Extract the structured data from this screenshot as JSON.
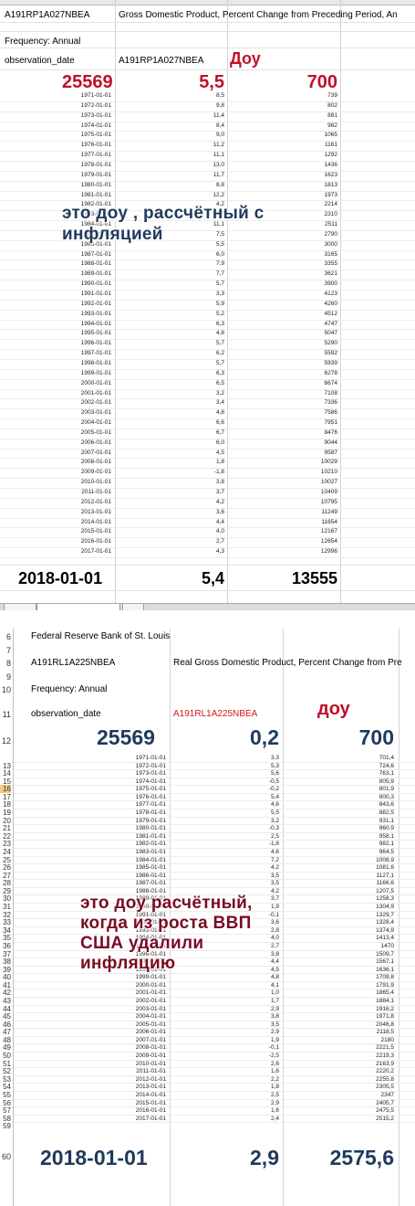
{
  "sheet1": {
    "header_cells": {
      "series_id": "A191RP1A027NBEA",
      "series_title": "Gross Domestic Product, Percent Change from Preceding Period, An",
      "frequency": "Frequency: Annual",
      "obs_date_label": "observation_date",
      "obs_series_label": "A191RP1A027NBEA",
      "dow_label": "Доу"
    },
    "first_row": {
      "date": "25569",
      "value": "5,5",
      "dow": "700"
    },
    "rows": [
      [
        "1971-01-01",
        "8,5",
        "739"
      ],
      [
        "1972-01-01",
        "9,8",
        "802"
      ],
      [
        "1973-01-01",
        "11,4",
        "881"
      ],
      [
        "1974-01-01",
        "8,4",
        "982"
      ],
      [
        "1975-01-01",
        "9,0",
        "1065"
      ],
      [
        "1976-01-01",
        "11,2",
        "1161"
      ],
      [
        "1977-01-01",
        "11,1",
        "1292"
      ],
      [
        "1978-01-01",
        "13,0",
        "1436"
      ],
      [
        "1979-01-01",
        "11,7",
        "1623"
      ],
      [
        "1980-01-01",
        "8,8",
        "1813"
      ],
      [
        "1981-01-01",
        "12,2",
        "1973"
      ],
      [
        "1982-01-01",
        "4,2",
        "2214"
      ],
      [
        "1983-01-01",
        "8,7",
        "2310"
      ],
      [
        "1984-01-01",
        "11,1",
        "2511"
      ],
      [
        "1985-01-01",
        "7,5",
        "2790"
      ],
      [
        "1986-01-01",
        "5,5",
        "3000"
      ],
      [
        "1987-01-01",
        "6,0",
        "3165"
      ],
      [
        "1988-01-01",
        "7,9",
        "3355"
      ],
      [
        "1989-01-01",
        "7,7",
        "3621"
      ],
      [
        "1990-01-01",
        "5,7",
        "3900"
      ],
      [
        "1991-01-01",
        "3,3",
        "4123"
      ],
      [
        "1992-01-01",
        "5,9",
        "4260"
      ],
      [
        "1993-01-01",
        "5,2",
        "4512"
      ],
      [
        "1994-01-01",
        "6,3",
        "4747"
      ],
      [
        "1995-01-01",
        "4,8",
        "5047"
      ],
      [
        "1996-01-01",
        "5,7",
        "5290"
      ],
      [
        "1997-01-01",
        "6,2",
        "5592"
      ],
      [
        "1998-01-01",
        "5,7",
        "5939"
      ],
      [
        "1999-01-01",
        "6,3",
        "6278"
      ],
      [
        "2000-01-01",
        "6,5",
        "6674"
      ],
      [
        "2001-01-01",
        "3,2",
        "7108"
      ],
      [
        "2002-01-01",
        "3,4",
        "7336"
      ],
      [
        "2003-01-01",
        "4,8",
        "7586"
      ],
      [
        "2004-01-01",
        "6,6",
        "7951"
      ],
      [
        "2005-01-01",
        "6,7",
        "8476"
      ],
      [
        "2006-01-01",
        "6,0",
        "9044"
      ],
      [
        "2007-01-01",
        "4,5",
        "9587"
      ],
      [
        "2008-01-01",
        "1,8",
        "10029"
      ],
      [
        "2009-01-01",
        "-1,8",
        "10210"
      ],
      [
        "2010-01-01",
        "3,8",
        "10027"
      ],
      [
        "2011-01-01",
        "3,7",
        "10409"
      ],
      [
        "2012-01-01",
        "4,2",
        "10795"
      ],
      [
        "2013-01-01",
        "3,6",
        "11249"
      ],
      [
        "2014-01-01",
        "4,4",
        "11654"
      ],
      [
        "2015-01-01",
        "4,0",
        "12167"
      ],
      [
        "2016-01-01",
        "2,7",
        "12654"
      ],
      [
        "2017-01-01",
        "4,3",
        "12996"
      ]
    ],
    "last_row": {
      "date": "2018-01-01",
      "value": "5,4",
      "dow": "13555"
    },
    "overlay_text": [
      "это доу , рассчётный с",
      "инфляцией"
    ]
  },
  "sheet2": {
    "row_numbers": [
      "6",
      "7",
      "8",
      "9",
      "10",
      "11",
      "12",
      "13",
      "14",
      "15",
      "16",
      "17",
      "18",
      "19",
      "20",
      "21",
      "22",
      "23",
      "24",
      "25",
      "26",
      "27",
      "28",
      "29",
      "30",
      "31",
      "32",
      "33",
      "34",
      "35",
      "36",
      "37",
      "38",
      "39",
      "40",
      "41",
      "42",
      "43",
      "44",
      "45",
      "46",
      "47",
      "48",
      "49",
      "50",
      "51",
      "52",
      "53",
      "54",
      "55",
      "56",
      "57",
      "58",
      "59",
      "60"
    ],
    "header_cells": {
      "source": "Federal Reserve Bank of St. Louis",
      "series_id": "A191RL1A225NBEA",
      "series_title": "Real Gross Domestic Product, Percent Change from Pre",
      "frequency": "Frequency: Annual",
      "obs_date_label": "observation_date",
      "obs_series_label": "A191RL1A225NBEA",
      "dow_label": "доу"
    },
    "first_row": {
      "date": "25569",
      "value": "0,2",
      "dow": "700"
    },
    "rows": [
      [
        "1971-01-01",
        "3,3",
        "701,4"
      ],
      [
        "1972-01-01",
        "5,3",
        "724,6"
      ],
      [
        "1973-01-01",
        "5,6",
        "763,1"
      ],
      [
        "1974-01-01",
        "-0,5",
        "805,9"
      ],
      [
        "1975-01-01",
        "-0,2",
        "801,9"
      ],
      [
        "1976-01-01",
        "5,4",
        "800,3"
      ],
      [
        "1977-01-01",
        "4,6",
        "843,6"
      ],
      [
        "1978-01-01",
        "5,5",
        "882,5"
      ],
      [
        "1979-01-01",
        "3,2",
        "931,1"
      ],
      [
        "1980-01-01",
        "-0,3",
        "960,9"
      ],
      [
        "1981-01-01",
        "2,5",
        "958,1"
      ],
      [
        "1982-01-01",
        "-1,8",
        "982,1"
      ],
      [
        "1983-01-01",
        "4,6",
        "964,5"
      ],
      [
        "1984-01-01",
        "7,2",
        "1008,9"
      ],
      [
        "1985-01-01",
        "4,2",
        "1081,6"
      ],
      [
        "1986-01-01",
        "3,5",
        "1127,1"
      ],
      [
        "1987-01-01",
        "3,5",
        "1166,6"
      ],
      [
        "1988-01-01",
        "4,2",
        "1207,5"
      ],
      [
        "1989-01-01",
        "3,7",
        "1258,3"
      ],
      [
        "1990-01-01",
        "1,9",
        "1304,9"
      ],
      [
        "1991-01-01",
        "-0,1",
        "1329,7"
      ],
      [
        "1992-01-01",
        "3,6",
        "1328,4"
      ],
      [
        "1993-01-01",
        "2,8",
        "1374,9"
      ],
      [
        "1994-01-01",
        "4,0",
        "1413,4"
      ],
      [
        "1995-01-01",
        "2,7",
        "1470"
      ],
      [
        "1996-01-01",
        "3,8",
        "1509,7"
      ],
      [
        "1997-01-01",
        "4,4",
        "1567,1"
      ],
      [
        "1998-01-01",
        "4,5",
        "1636,1"
      ],
      [
        "1999-01-01",
        "4,8",
        "1709,8"
      ],
      [
        "2000-01-01",
        "4,1",
        "1791,9"
      ],
      [
        "2001-01-01",
        "1,0",
        "1865,4"
      ],
      [
        "2002-01-01",
        "1,7",
        "1884,1"
      ],
      [
        "2003-01-01",
        "2,9",
        "1916,2"
      ],
      [
        "2004-01-01",
        "3,8",
        "1971,8"
      ],
      [
        "2005-01-01",
        "3,5",
        "2046,8"
      ],
      [
        "2006-01-01",
        "2,9",
        "2118,5"
      ],
      [
        "2007-01-01",
        "1,9",
        "2180"
      ],
      [
        "2008-01-01",
        "-0,1",
        "2221,5"
      ],
      [
        "2009-01-01",
        "-2,5",
        "2219,3"
      ],
      [
        "2010-01-01",
        "2,6",
        "2163,9"
      ],
      [
        "2011-01-01",
        "1,6",
        "2220,2"
      ],
      [
        "2012-01-01",
        "2,2",
        "2255,8"
      ],
      [
        "2013-01-01",
        "1,8",
        "2305,5"
      ],
      [
        "2014-01-01",
        "2,5",
        "2347"
      ],
      [
        "2015-01-01",
        "2,9",
        "2405,7"
      ],
      [
        "2016-01-01",
        "1,6",
        "2475,5"
      ],
      [
        "2017-01-01",
        "2,4",
        "2515,2"
      ]
    ],
    "last_row": {
      "date": "2018-01-01",
      "value": "2,9",
      "dow": "2575,6"
    },
    "overlay_text": [
      "это доу расчётный,",
      "когда из роста ВВП",
      "США удалили",
      "инфляцию"
    ]
  }
}
